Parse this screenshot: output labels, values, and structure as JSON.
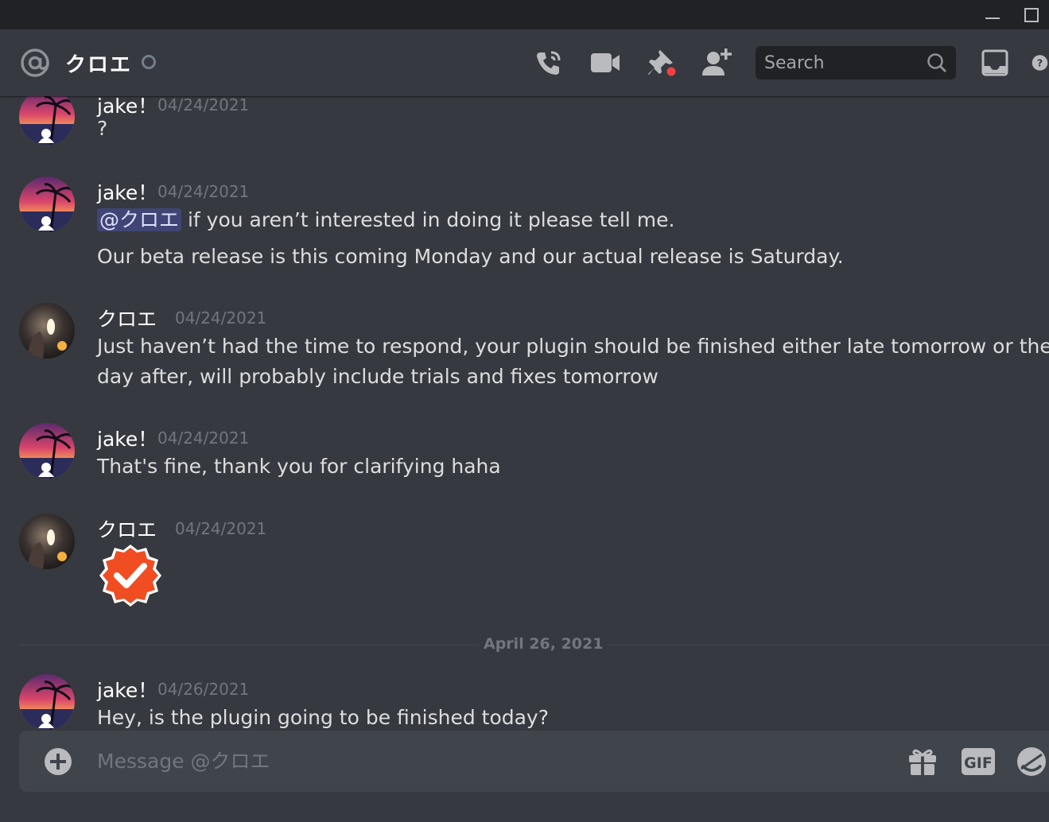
{
  "window": {
    "minimize_label": "minimize",
    "maximize_label": "maximize"
  },
  "header": {
    "channel_name": "クロエ",
    "search_placeholder": "Search",
    "icons": [
      "at-icon",
      "status-icon",
      "call-icon",
      "video-icon",
      "pin-icon",
      "add-friend-icon",
      "search-icon",
      "inbox-icon",
      "help-icon"
    ]
  },
  "messages": [
    {
      "author": "jake！",
      "timestamp": "04/24/2021",
      "lines": [
        "?"
      ]
    },
    {
      "author": "jake！",
      "timestamp": "04/24/2021",
      "mention": "@クロエ",
      "lines": [
        "if you aren’t interested in doing it please tell me.",
        "Our beta release is this coming Monday and our actual release is  Saturday."
      ]
    },
    {
      "author": "クロエ",
      "timestamp": "04/24/2021",
      "lines": [
        "Just haven’t had the time to respond, your plugin should be finished either late tomorrow or the",
        "day after, will probably include trials and fixes tomorrow"
      ]
    },
    {
      "author": "jake！",
      "timestamp": "04/24/2021",
      "lines": [
        "That's fine, thank you for clarifying haha"
      ]
    },
    {
      "author": "クロエ",
      "timestamp": "04/24/2021",
      "emoji": "verified-check-emoji"
    },
    {
      "author": "jake！",
      "timestamp": "04/26/2021",
      "lines": [
        "Hey, is the plugin going to be finished today?"
      ]
    }
  ],
  "date_divider": "April 26, 2021",
  "composer": {
    "placeholder": "Message @クロエ",
    "gif_label": "GIF",
    "icons": [
      "plus-icon",
      "gift-icon",
      "gif-icon",
      "emoji-icon"
    ]
  },
  "colors": {
    "background": "#36393f",
    "titlebar": "#202225",
    "mention_bg": "#4c5596",
    "accent_red": "#ed4245",
    "emoji_red": "#f04d23"
  }
}
